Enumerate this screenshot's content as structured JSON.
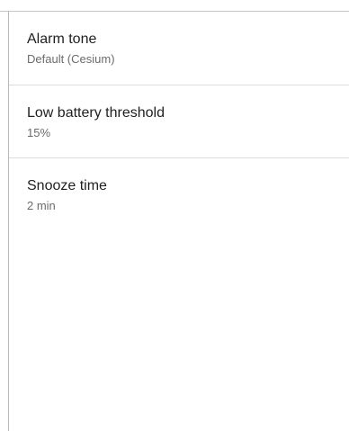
{
  "settings": {
    "items": [
      {
        "title": "Alarm tone",
        "summary": "Default (Cesium)"
      },
      {
        "title": "Low battery threshold",
        "summary": "15%"
      },
      {
        "title": "Snooze time",
        "summary": "2 min"
      }
    ]
  },
  "colors": {
    "title_text": "#1f1f1f",
    "summary_text": "#6b6b6b",
    "divider": "#dcdcdc",
    "border": "#b9b9b9",
    "background": "#ffffff"
  }
}
